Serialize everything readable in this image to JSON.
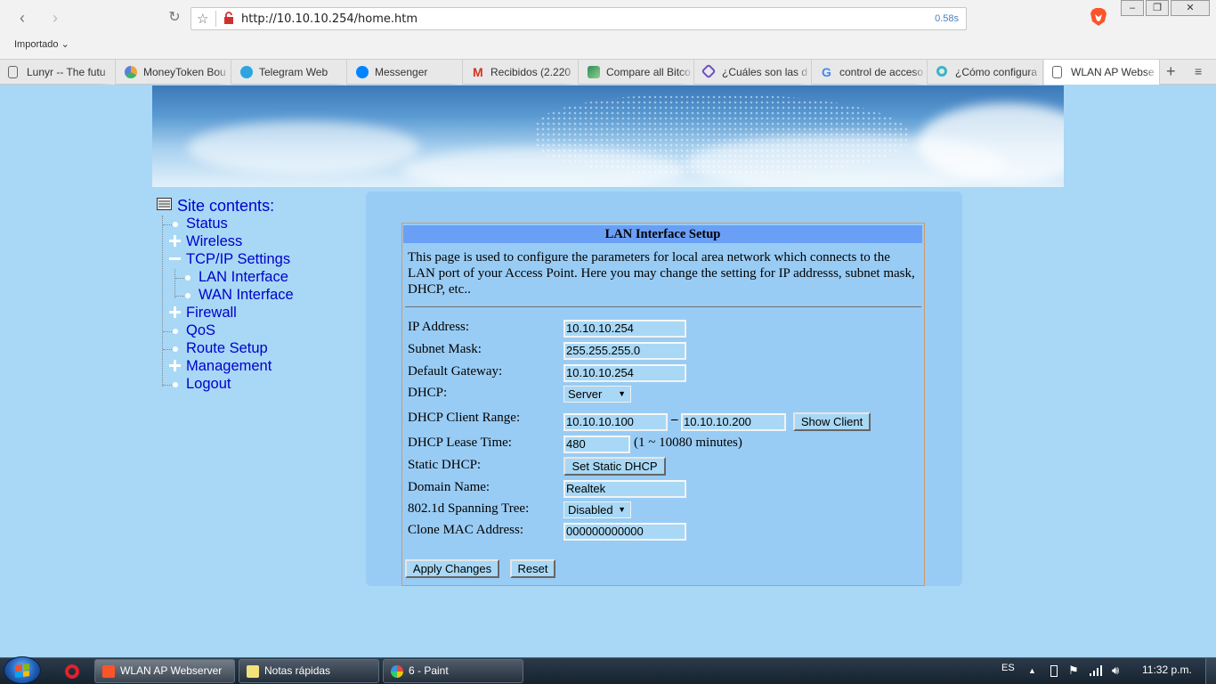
{
  "browser": {
    "url": "http://10.10.10.254/home.htm",
    "load_time": "0.58s",
    "bookmark_folder": "Importado",
    "tabs": [
      {
        "label": "Lunyr -- The futu",
        "icon": "page-icon",
        "color": "#ffffff"
      },
      {
        "label": "MoneyToken Bou",
        "icon": "moneytoken-icon",
        "color": "#f2a23a"
      },
      {
        "label": "Telegram Web",
        "icon": "telegram-icon",
        "color": "#2ca5e0"
      },
      {
        "label": "Messenger",
        "icon": "messenger-icon",
        "color": "#0084ff"
      },
      {
        "label": "Recibidos (2.220",
        "icon": "gmail-icon",
        "color": "#d93025"
      },
      {
        "label": "Compare all Bitco",
        "icon": "chart-icon",
        "color": "#2e8b57"
      },
      {
        "label": "¿Cuáles son las d",
        "icon": "cube-icon",
        "color": "#6a4fc0"
      },
      {
        "label": "control de acceso",
        "icon": "google-icon",
        "color": "#4285f4"
      },
      {
        "label": "¿Cómo configura",
        "icon": "tplink-icon",
        "color": "#3bb5c8"
      },
      {
        "label": "WLAN AP Webse",
        "icon": "page-icon",
        "color": "#ffffff"
      }
    ]
  },
  "sidebar": {
    "title": "Site contents:",
    "items": [
      {
        "label": "Status",
        "kind": "leaf"
      },
      {
        "label": "Wireless",
        "kind": "collapsed"
      },
      {
        "label": "TCP/IP Settings",
        "kind": "expanded"
      },
      {
        "label": "LAN Interface",
        "kind": "child"
      },
      {
        "label": "WAN Interface",
        "kind": "child"
      },
      {
        "label": "Firewall",
        "kind": "collapsed"
      },
      {
        "label": "QoS",
        "kind": "leaf"
      },
      {
        "label": "Route Setup",
        "kind": "leaf"
      },
      {
        "label": "Management",
        "kind": "collapsed"
      },
      {
        "label": "Logout",
        "kind": "leaf"
      }
    ]
  },
  "form": {
    "title": "LAN Interface Setup",
    "description": "This page is used to configure the parameters for local area network which connects to the LAN port of your Access Point. Here you may change the setting for IP addresss, subnet mask, DHCP, etc..",
    "labels": {
      "ip": "IP Address:",
      "mask": "Subnet Mask:",
      "gateway": "Default Gateway:",
      "dhcp": "DHCP:",
      "range": "DHCP Client Range:",
      "lease": "DHCP Lease Time:",
      "static": "Static DHCP:",
      "domain": "Domain Name:",
      "stp": "802.1d Spanning Tree:",
      "mac": "Clone MAC Address:"
    },
    "values": {
      "ip": "10.10.10.254",
      "mask": "255.255.255.0",
      "gateway": "10.10.10.254",
      "dhcp": "Server",
      "range_start": "10.10.10.100",
      "range_sep": "–",
      "range_end": "10.10.10.200",
      "lease": "480",
      "lease_unit": "(1 ~ 10080 minutes)",
      "domain": "Realtek",
      "stp": "Disabled",
      "mac": "000000000000"
    },
    "buttons": {
      "show_client": "Show Client",
      "set_static": "Set Static DHCP",
      "apply": "Apply Changes",
      "reset": "Reset"
    }
  },
  "taskbar": {
    "items": [
      {
        "label": "WLAN AP Webserver",
        "icon": "brave-icon"
      },
      {
        "label": "Notas rápidas",
        "icon": "sticky-notes-icon"
      },
      {
        "label": "6 - Paint",
        "icon": "paint-icon"
      }
    ],
    "language": "ES",
    "clock": "11:32 p.m."
  }
}
